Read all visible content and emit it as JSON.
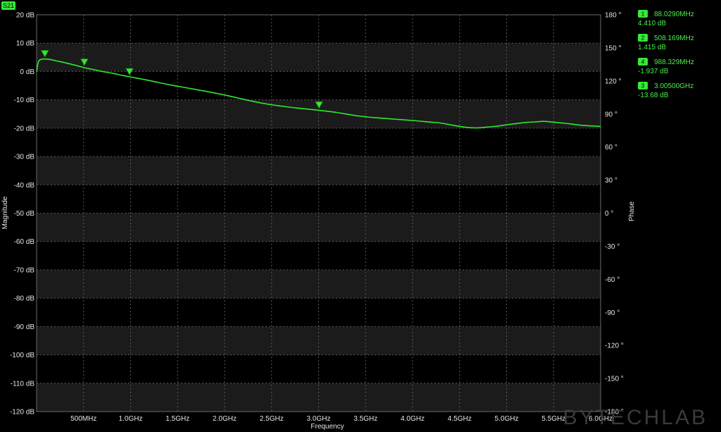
{
  "trace_tag": "S21",
  "watermark": "BYTECHLAB",
  "chart_data": {
    "type": "line",
    "xlabel": "Frequency",
    "ylabel_left": "Magnitude",
    "ylabel_right": "Phase",
    "xlim_mhz": [
      0,
      6000
    ],
    "ylim_db": [
      -120,
      20
    ],
    "ylim_phase_deg": [
      -180,
      180
    ],
    "x_ticks": [
      {
        "value": 500,
        "label": "500MHz"
      },
      {
        "value": 1000,
        "label": "1.0GHz"
      },
      {
        "value": 1500,
        "label": "1.5GHz"
      },
      {
        "value": 2000,
        "label": "2.0GHz"
      },
      {
        "value": 2500,
        "label": "2.5GHz"
      },
      {
        "value": 3000,
        "label": "3.0GHz"
      },
      {
        "value": 3500,
        "label": "3.5GHz"
      },
      {
        "value": 4000,
        "label": "4.0GHz"
      },
      {
        "value": 4500,
        "label": "4.5GHz"
      },
      {
        "value": 5000,
        "label": "5.0GHz"
      },
      {
        "value": 5500,
        "label": "5.5GHz"
      },
      {
        "value": 6000,
        "label": "6.0GHz"
      }
    ],
    "y_ticks_left": [
      {
        "value": 20,
        "label": "20 dB"
      },
      {
        "value": 10,
        "label": "10 dB"
      },
      {
        "value": 0,
        "label": "0 dB"
      },
      {
        "value": -10,
        "label": "-10 dB"
      },
      {
        "value": -20,
        "label": "-20 dB"
      },
      {
        "value": -30,
        "label": "-30 dB"
      },
      {
        "value": -40,
        "label": "-40 dB"
      },
      {
        "value": -50,
        "label": "-50 dB"
      },
      {
        "value": -60,
        "label": "-60 dB"
      },
      {
        "value": -70,
        "label": "-70 dB"
      },
      {
        "value": -80,
        "label": "-80 dB"
      },
      {
        "value": -90,
        "label": "-90 dB"
      },
      {
        "value": -100,
        "label": "-100 dB"
      },
      {
        "value": -110,
        "label": "-110 dB"
      },
      {
        "value": -120,
        "label": "-120 dB"
      }
    ],
    "y_ticks_right": [
      {
        "value": 180,
        "label": "180 °"
      },
      {
        "value": 150,
        "label": "150 °"
      },
      {
        "value": 120,
        "label": "120 °"
      },
      {
        "value": 90,
        "label": "90 °"
      },
      {
        "value": 60,
        "label": "60 °"
      },
      {
        "value": 30,
        "label": "30 °"
      },
      {
        "value": 0,
        "label": "0 °"
      },
      {
        "value": -30,
        "label": "-30 °"
      },
      {
        "value": -60,
        "label": "-60 °"
      },
      {
        "value": -90,
        "label": "-90 °"
      },
      {
        "value": -120,
        "label": "-120 °"
      },
      {
        "value": -150,
        "label": "-150 °"
      },
      {
        "value": -180,
        "label": "-180 °"
      }
    ],
    "series": [
      {
        "color": "#2ee82e",
        "x_mhz": [
          0,
          20,
          50,
          88,
          150,
          200,
          300,
          400,
          500,
          600,
          700,
          800,
          900,
          1000,
          1200,
          1400,
          1600,
          1800,
          2000,
          2200,
          2400,
          2600,
          2800,
          3000,
          3200,
          3400,
          3600,
          3800,
          4000,
          4100,
          4200,
          4300,
          4400,
          4500,
          4600,
          4700,
          4800,
          4900,
          5000,
          5100,
          5200,
          5300,
          5400,
          5500,
          5600,
          5700,
          5800,
          5900,
          6000
        ],
        "y_db": [
          0,
          3.5,
          4.3,
          4.41,
          4.2,
          3.8,
          3.1,
          2.3,
          1.42,
          0.7,
          0.0,
          -0.6,
          -1.3,
          -1.94,
          -3.2,
          -4.6,
          -5.8,
          -7.0,
          -8.3,
          -9.8,
          -11.2,
          -12.2,
          -13.0,
          -13.68,
          -14.5,
          -15.6,
          -16.3,
          -16.8,
          -17.3,
          -17.6,
          -17.9,
          -18.2,
          -18.8,
          -19.4,
          -19.8,
          -19.9,
          -19.6,
          -19.3,
          -18.8,
          -18.4,
          -18.0,
          -17.8,
          -17.6,
          -17.9,
          -18.2,
          -18.6,
          -19.0,
          -19.2,
          -19.4
        ]
      }
    ],
    "markers": [
      {
        "id": "1",
        "freq_mhz": 88.029,
        "db": 4.41,
        "freq_label": "88.0290MHz",
        "value_label": "4.410 dB"
      },
      {
        "id": "2",
        "freq_mhz": 508.169,
        "db": 1.415,
        "freq_label": "508.169MHz",
        "value_label": "1.415 dB"
      },
      {
        "id": "4",
        "freq_mhz": 988.329,
        "db": -1.937,
        "freq_label": "988.329MHz",
        "value_label": "-1.937 dB"
      },
      {
        "id": "3",
        "freq_mhz": 3005.0,
        "db": -13.68,
        "freq_label": "3.00500GHz",
        "value_label": "-13.68 dB"
      }
    ],
    "grid": true,
    "legend_position": "right"
  }
}
